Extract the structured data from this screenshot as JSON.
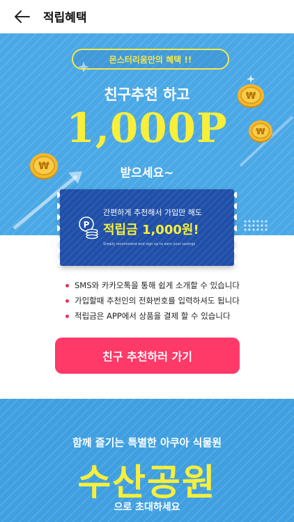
{
  "header": {
    "back_icon": "arrow-left-icon",
    "title": "적립혜택"
  },
  "promo": {
    "badge": "몬스터리움만의 혜택 !!",
    "headline_top": "친구추천 하고",
    "headline_big": "1,000P",
    "headline_bottom": "받으세요~",
    "coin_icon": "won-coin-icon",
    "colors": {
      "background": "#4aa8e6",
      "highlight": "#f7ef3a"
    }
  },
  "ticket": {
    "icon": "point-coins-icon",
    "line1": "간편하게 추천해서 가입만 해도",
    "line2": "적립금 1,000원!",
    "line3": "Simply recommend and sign up to earn your savings"
  },
  "bullets": [
    "SMS와 카카오톡을 통해 쉽게 소개할 수 있습니다",
    "가입할때 추천인의 전화번호를 입력하셔도 됩니다",
    "적립금은 APP에서 상품을 결제 할 수 있습니다"
  ],
  "cta": {
    "label": "친구 추천하러 가기",
    "color": "#ff3968"
  },
  "promo2": {
    "line1": "함께 즐기는 특별한 아쿠아 식물원",
    "big": "수산공원",
    "line2": "으로 초대하세요"
  }
}
